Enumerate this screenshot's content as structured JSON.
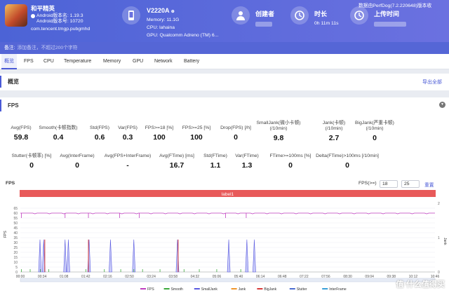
{
  "header": {
    "app_name": "和平精英",
    "android_version": "Android版本名: 1.19.3",
    "android_code": "Android版本号: 10720",
    "package": "com.tencent.tmgp.pubgmhd",
    "device_name": "V2220A",
    "device_badge": "⊕",
    "memory": "Memory: 11.1G",
    "cpu": "CPU: lahaina",
    "gpu": "GPU: Qualcomm Adreno (TM) 6...",
    "creator_label": "创建者",
    "duration_label": "时长",
    "duration_value": "0h 11m 11s",
    "upload_label": "上传时间",
    "source": "数据由PerfDog(7.2.220648)版本收"
  },
  "note": {
    "label": "备注:",
    "placeholder": "添加备注，不超过200个字符"
  },
  "tabs": [
    "概览",
    "FPS",
    "CPU",
    "Temperature",
    "Memory",
    "GPU",
    "Network",
    "Battery"
  ],
  "overview": {
    "title": "概览",
    "export": "导出全部"
  },
  "fps": {
    "title": "FPS",
    "row1": [
      {
        "label": "Avg(FPS)",
        "value": "59.8"
      },
      {
        "label": "Smooth(卡顿指数)",
        "value": "0.4"
      },
      {
        "label": "Std(FPS)",
        "value": "0.6"
      },
      {
        "label": "Var(FPS)",
        "value": "0.3"
      },
      {
        "label": "FPS>=18 [%]",
        "value": "100"
      },
      {
        "label": "FPS>=25 [%]",
        "value": "100"
      },
      {
        "label": "Drop(FPS) [/h]",
        "value": "0"
      },
      {
        "label": "SmallJank(微小卡顿)",
        "label2": "(/10min)",
        "value": "9.8"
      },
      {
        "label": "Jank(卡顿)",
        "label2": "(/10min)",
        "value": "2.7"
      },
      {
        "label": "BigJank(严重卡顿)",
        "label2": "(/10min)",
        "value": "0"
      }
    ],
    "row2": [
      {
        "label": "Stutter(卡顿率) [%]",
        "value": "0"
      },
      {
        "label": "Avg(InterFrame)",
        "value": "0"
      },
      {
        "label": "Avg(FPS+InterFrame)",
        "value": "-"
      },
      {
        "label": "Avg(FTime) [ms]",
        "value": "16.7"
      },
      {
        "label": "Std(FTime)",
        "value": "1.1"
      },
      {
        "label": "Var(FTime)",
        "value": "1.3"
      },
      {
        "label": "FTime>=100ms [%]",
        "value": "0"
      },
      {
        "label": "Delta(FTime)>100ms [/10min]",
        "value": "0"
      }
    ],
    "chart_label": "FPS",
    "filter_label": "FPS(>=)",
    "filter_v1": "18",
    "filter_v2": "25",
    "reset": "重置"
  },
  "chart_data": {
    "type": "line",
    "label_bar": "label1",
    "ylabel": "FPS",
    "y2label": "Jank",
    "ylim": [
      0,
      70
    ],
    "yticks": [
      "0",
      "5",
      "10",
      "15",
      "20",
      "25",
      "30",
      "35",
      "40",
      "45",
      "50",
      "55",
      "60",
      "65"
    ],
    "y2ticks": [
      "0",
      "1",
      "2"
    ],
    "x": [
      "00:00",
      "00:34",
      "01:08",
      "01:42",
      "02:16",
      "02:50",
      "03:24",
      "03:58",
      "04:32",
      "05:06",
      "05:40",
      "06:14",
      "06:48",
      "07:22",
      "07:56",
      "08:30",
      "09:04",
      "09:38",
      "10:12",
      "10:46"
    ],
    "fps_baseline": 60,
    "fps_drops_at": [
      0.05,
      2.05,
      3.12,
      4.55,
      5.45,
      9.4,
      10.35
    ],
    "small_jank_at": [
      0.9,
      1.07,
      2.05,
      2.2,
      3.15,
      4.13,
      5.2,
      7.2,
      9.55,
      10.38,
      10.72
    ],
    "jank_at": [
      1.12,
      3.12,
      7.23
    ],
    "smooth_dots_at": [
      0.05,
      0.45,
      0.92,
      1.3,
      3.0,
      3.85,
      4.6,
      5.2,
      5.6,
      6.4,
      7.5,
      8.2,
      9.0,
      10.1
    ],
    "legend": [
      {
        "name": "FPS",
        "color": "#c03ec0"
      },
      {
        "name": "Smooth",
        "color": "#3ca83c"
      },
      {
        "name": "SmallJank",
        "color": "#5a5ae0"
      },
      {
        "name": "Jank",
        "color": "#f0962c"
      },
      {
        "name": "BigJank",
        "color": "#d83a3a"
      },
      {
        "name": "Stutter",
        "color": "#4a6cd0"
      },
      {
        "name": "InterFrame",
        "color": "#3aa0d8"
      }
    ]
  },
  "watermark": "值·什么值得买"
}
